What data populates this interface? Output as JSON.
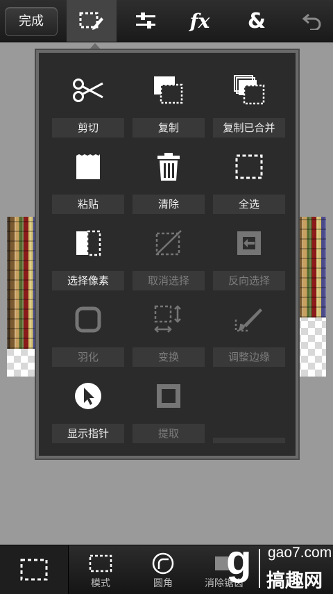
{
  "toolbar": {
    "done_label": "完成",
    "tools": [
      {
        "icon": "selection-edit-icon",
        "active": true
      },
      {
        "icon": "adjustments-sliders-icon",
        "active": false
      },
      {
        "icon": "fx-icon",
        "label": "fx",
        "active": false
      },
      {
        "icon": "ampersand-icon",
        "label": "&",
        "active": false
      },
      {
        "icon": "undo-icon",
        "active": false
      }
    ]
  },
  "menu": {
    "items": [
      {
        "label": "剪切",
        "icon": "scissors-icon",
        "enabled": true
      },
      {
        "label": "复制",
        "icon": "copy-icon",
        "enabled": true
      },
      {
        "label": "复制已合并",
        "icon": "copy-merged-icon",
        "enabled": true
      },
      {
        "label": "粘贴",
        "icon": "paste-icon",
        "enabled": true
      },
      {
        "label": "清除",
        "icon": "trash-icon",
        "enabled": true
      },
      {
        "label": "全选",
        "icon": "select-all-icon",
        "enabled": true
      },
      {
        "label": "选择像素",
        "icon": "select-pixels-icon",
        "enabled": true
      },
      {
        "label": "取消选择",
        "icon": "deselect-icon",
        "enabled": false
      },
      {
        "label": "反向选择",
        "icon": "invert-selection-icon",
        "enabled": false
      },
      {
        "label": "羽化",
        "icon": "feather-icon",
        "enabled": false
      },
      {
        "label": "变换",
        "icon": "transform-icon",
        "enabled": false
      },
      {
        "label": "调整边缘",
        "icon": "refine-edge-icon",
        "enabled": false
      },
      {
        "label": "显示指针",
        "icon": "show-pointer-icon",
        "enabled": true
      },
      {
        "label": "提取",
        "icon": "extract-icon",
        "enabled": false
      }
    ]
  },
  "bottombar": {
    "items": [
      {
        "label": "模式",
        "icon": "selection-mode-icon"
      },
      {
        "label": "圆角",
        "icon": "rounded-corner-icon"
      },
      {
        "label": "消除锯齿",
        "icon": "antialias-icon"
      }
    ]
  },
  "watermark": {
    "logo_letter": "g",
    "domain": "gao7.com",
    "name": "搞趣网"
  },
  "colors": {
    "panel_bg": "#2b2b2b",
    "label_bg": "#393939",
    "enabled_text": "#f0f0f0",
    "disabled_text": "#7d7d7d"
  }
}
